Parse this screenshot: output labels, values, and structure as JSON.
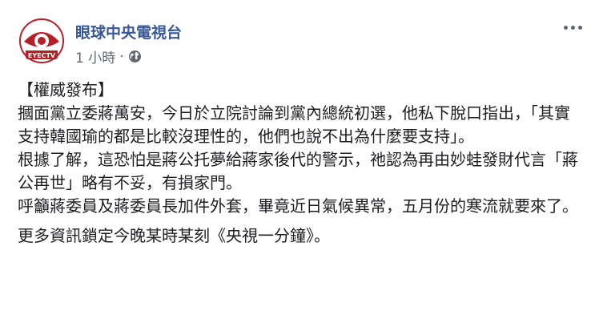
{
  "post": {
    "page_name": "眼球中央電視台",
    "time": "1 小時",
    "separator": "·",
    "avatar_text": "EYECTV",
    "icons": {
      "privacy": "globe-icon",
      "more": "more-options-icon"
    },
    "paragraphs": [
      "【權威發布】",
      "摑面黨立委蔣萬安，今日於立院討論到黨內總統初選，他私下脫口指出，「其實支持韓國瑜的都是比較沒理性的，他們也說不出為什麼要支持」。",
      "根據了解，這恐怕是蔣公托夢給蔣家後代的警示，祂認為再由妙蛙發財代言「蔣公再世」略有不妥，有損家門。",
      "呼籲蔣委員及蔣委員長加件外套，畢竟近日氣候異常，五月份的寒流就要來了。"
    ],
    "footer_line": "更多資訊鎖定今晚某時某刻《央視一分鐘》。"
  },
  "colors": {
    "page_name": "#385898",
    "meta": "#606770",
    "text": "#1c1e21",
    "logo_red": "#b3202a"
  }
}
